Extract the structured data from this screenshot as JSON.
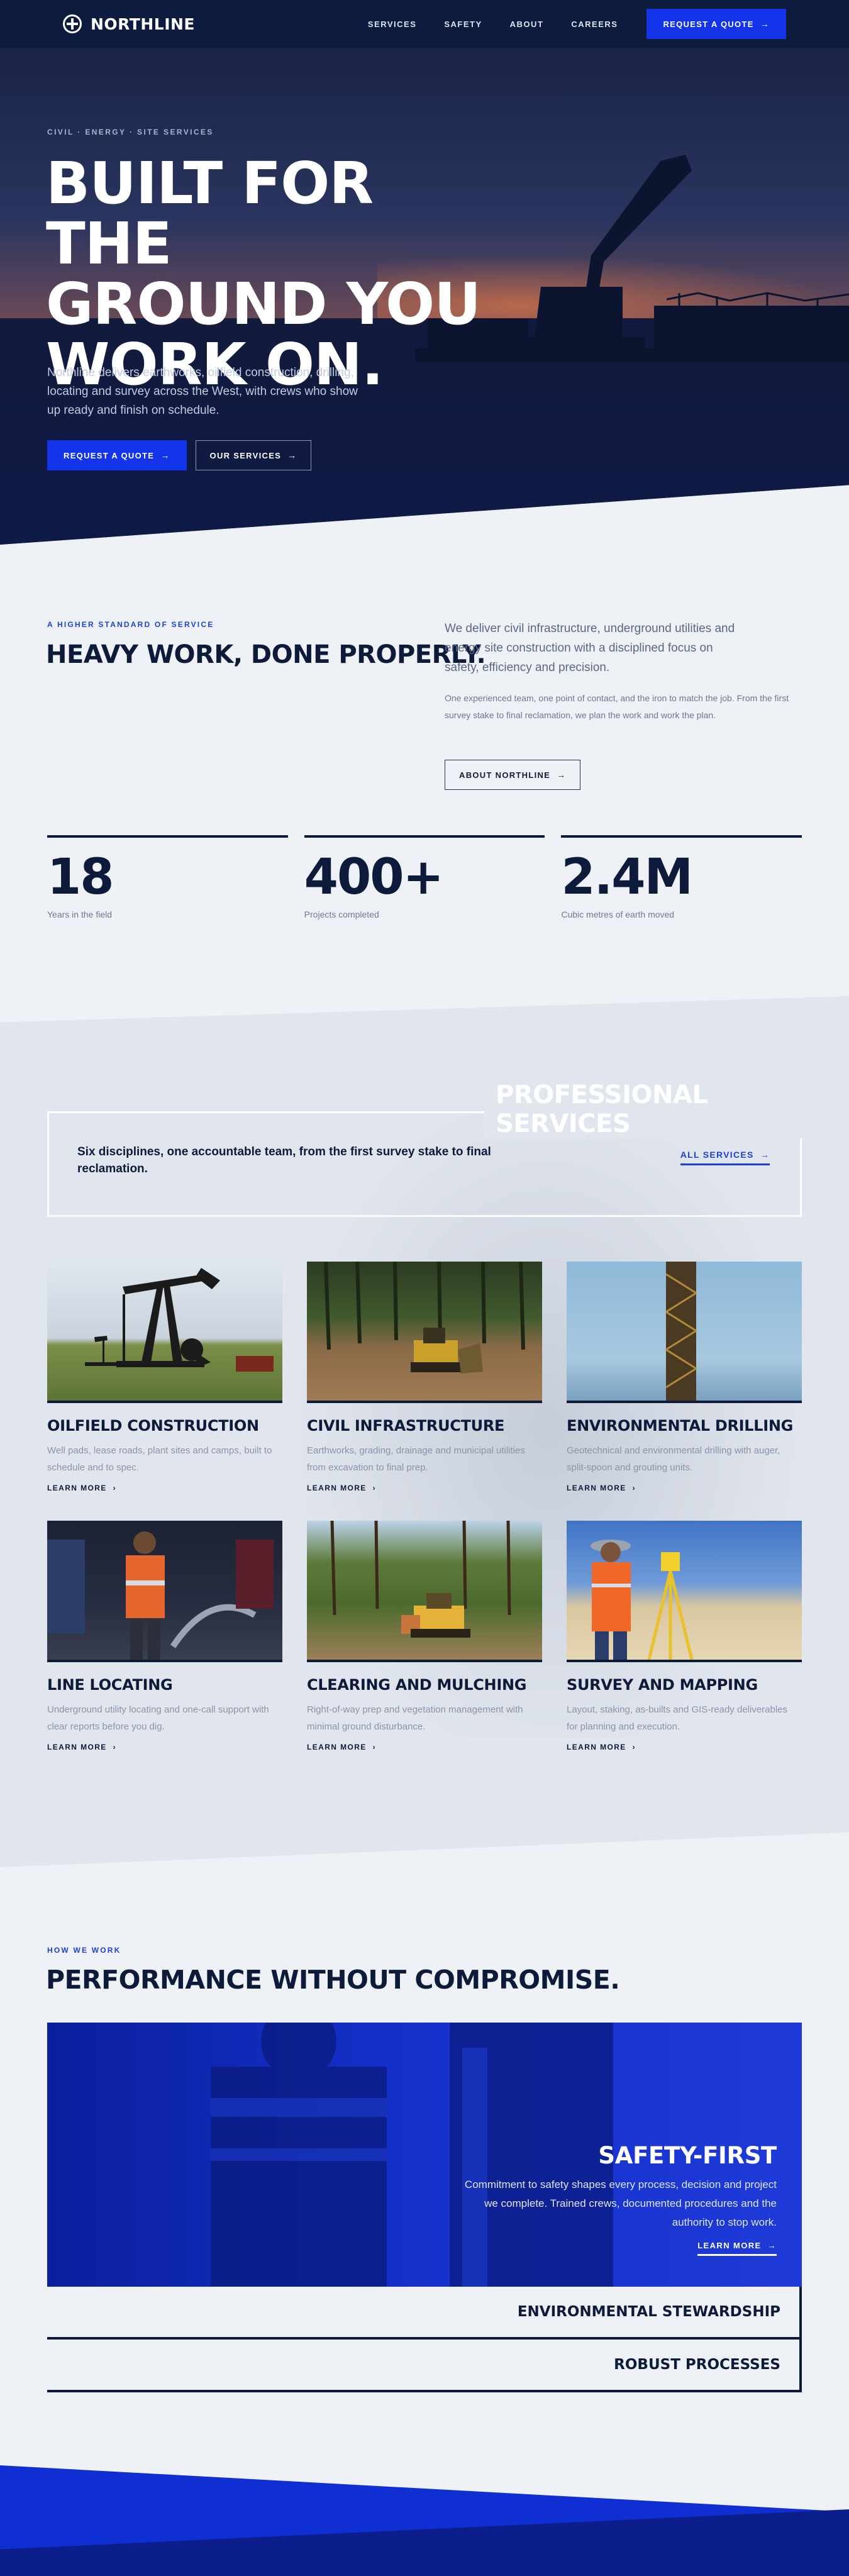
{
  "brand": {
    "name": "NORTHLINE"
  },
  "nav": {
    "links": [
      "SERVICES",
      "SAFETY",
      "ABOUT",
      "CAREERS"
    ],
    "cta": "REQUEST A QUOTE"
  },
  "hero": {
    "eyebrow": "CIVIL · ENERGY · SITE SERVICES",
    "title_line1": "BUILT FOR THE",
    "title_line2": "GROUND YOU",
    "title_line3": "WORK ON.",
    "text": "Northline delivers earthworks, oilfield construction, drilling, locating and survey across the West, with crews who show up ready and finish on schedule.",
    "primary_cta": "REQUEST A QUOTE",
    "secondary_cta": "OUR SERVICES"
  },
  "about": {
    "eyebrow": "A HIGHER STANDARD OF SERVICE",
    "title": "HEAVY WORK, DONE PROPERLY.",
    "lead": "We deliver civil infrastructure, underground utilities and energy site construction with a disciplined focus on safety, efficiency and precision.",
    "body": "One experienced team, one point of contact, and the iron to match the job. From the first survey stake to final reclamation, we plan the work and work the plan.",
    "cta": "ABOUT NORTHLINE"
  },
  "stats": [
    {
      "value": "18",
      "label": "Years in the field"
    },
    {
      "value": "400+",
      "label": "Projects completed"
    },
    {
      "value": "2.4M",
      "label": "Cubic metres of earth moved"
    }
  ],
  "services": {
    "heading": "PROFESSIONAL SERVICES",
    "intro": "Six disciplines, one accountable team, from the first survey stake to final reclamation.",
    "all_link": "ALL SERVICES",
    "items": [
      {
        "title": "OILFIELD CONSTRUCTION",
        "desc": "Well pads, lease roads, plant sites and camps, built to schedule and to spec.",
        "link": "LEARN MORE"
      },
      {
        "title": "CIVIL INFRASTRUCTURE",
        "desc": "Earthworks, grading, drainage and municipal utilities from excavation to final prep.",
        "link": "LEARN MORE"
      },
      {
        "title": "ENVIRONMENTAL DRILLING",
        "desc": "Geotechnical and environmental drilling with auger, split-spoon and grouting units.",
        "link": "LEARN MORE"
      },
      {
        "title": "LINE LOCATING",
        "desc": "Underground utility locating and one-call support with clear reports before you dig.",
        "link": "LEARN MORE"
      },
      {
        "title": "CLEARING AND MULCHING",
        "desc": "Right-of-way prep and vegetation management with minimal ground disturbance.",
        "link": "LEARN MORE"
      },
      {
        "title": "SURVEY AND MAPPING",
        "desc": "Layout, staking, as-builts and GIS-ready deliverables for planning and execution.",
        "link": "LEARN MORE"
      }
    ]
  },
  "performance": {
    "eyebrow": "HOW WE WORK",
    "title": "PERFORMANCE WITHOUT COMPROMISE.",
    "panel_title": "SAFETY-FIRST",
    "panel_text": "Commitment to safety shapes every process, decision and project we complete. Trained crews, documented procedures and the authority to stop work.",
    "panel_link": "LEARN MORE",
    "rows": [
      "ENVIRONMENTAL STEWARDSHIP",
      "ROBUST PROCESSES"
    ]
  },
  "colors": {
    "navy": "#0d1b3e",
    "accent": "#1334e8",
    "page": "#eef2f7"
  }
}
